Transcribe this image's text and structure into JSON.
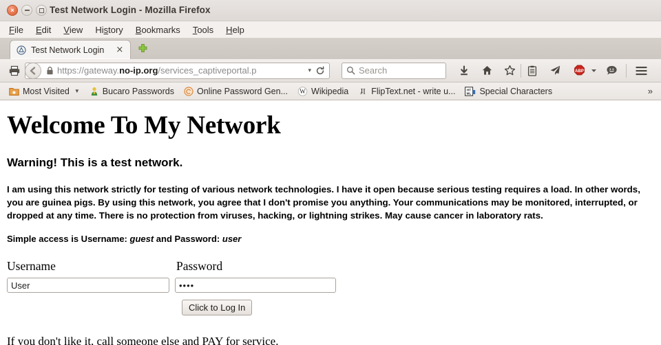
{
  "window": {
    "title": "Test Network Login - Mozilla Firefox",
    "close_glyph": "×"
  },
  "menubar": {
    "items": [
      {
        "label": "File",
        "accel": "F",
        "rest": "ile"
      },
      {
        "label": "Edit",
        "accel": "E",
        "rest": "dit"
      },
      {
        "label": "View",
        "accel": "V",
        "rest": "iew"
      },
      {
        "label": "History",
        "accel": "Hi",
        "rest": "story"
      },
      {
        "label": "Bookmarks",
        "accel": "B",
        "rest": "ookmarks"
      },
      {
        "label": "Tools",
        "accel": "T",
        "rest": "ools"
      },
      {
        "label": "Help",
        "accel": "H",
        "rest": "elp"
      }
    ]
  },
  "tabs": {
    "active": {
      "label": "Test Network Login",
      "favicon": "globe-triangle-icon",
      "close_glyph": "×"
    },
    "newtab_tooltip": "+"
  },
  "navbar": {
    "print_icon": "printer-icon",
    "back_icon": "back-arrow-icon",
    "lock_icon": "padlock-icon",
    "url_prefix": "https://gateway.",
    "url_domain": "no-ip.org",
    "url_suffix": "/services_captiveportal.p",
    "url_full": "https://gateway.no-ip.org/services_captiveportal.p",
    "dropdown_glyph": "▾",
    "reload_icon": "reload-icon",
    "search_placeholder": "Search",
    "search_icon": "search-icon",
    "icons": [
      "download-icon",
      "home-icon",
      "star-bookmark-icon",
      "reader-list-icon",
      "paper-plane-icon",
      "adblock-plus-icon",
      "chevron-down-icon",
      "chat-bubble-icon",
      "hamburger-menu-icon"
    ],
    "adblock_label": "ABP"
  },
  "bookmarks": {
    "items": [
      {
        "label": "Most Visited",
        "icon": "folder-star-icon",
        "has_caret": true
      },
      {
        "label": "Bucaro Passwords",
        "icon": "person-key-icon",
        "has_caret": false
      },
      {
        "label": "Online Password Gen...",
        "icon": "circle-swirl-icon",
        "has_caret": false
      },
      {
        "label": "Wikipedia",
        "icon": "wikipedia-w-icon",
        "has_caret": false
      },
      {
        "label": "FlipText.net - write u...",
        "icon": "fliptext-icon",
        "has_caret": false
      },
      {
        "label": "Special Characters",
        "icon": "html-badge-icon",
        "has_caret": false
      }
    ],
    "overflow_glyph": "»"
  },
  "page": {
    "heading": "Welcome To My Network",
    "warning": "Warning!  This is a test network.",
    "disclaimer": "I am using this network strictly for testing of various network technologies. I have it open because serious testing requires a load. In other words, you are guinea pigs. By using this network, you agree that I don't promise you anything. Your communications may be monitored, interrupted, or dropped at any time. There is no protection from viruses, hacking, or lightning strikes. May cause cancer in laboratory rats.",
    "simple_access_prefix": "Simple access is Username: ",
    "simple_access_username": "guest",
    "simple_access_middle": " and Password: ",
    "simple_access_password": "user",
    "form": {
      "username_label": "Username",
      "password_label": "Password",
      "username_value": "User",
      "password_value": "••••",
      "password_plain_length": 4,
      "submit_label": "Click to Log In"
    },
    "footer": "If you don't like it, call someone else and PAY for service."
  },
  "colors": {
    "close_button": "#e4734b",
    "newtab_green": "#8cc63e",
    "adblock_red": "#c8261e",
    "bookmark_folder_orange": "#e07b22",
    "page_background": "#ffffff",
    "chrome_background": "#e8e4e1"
  }
}
